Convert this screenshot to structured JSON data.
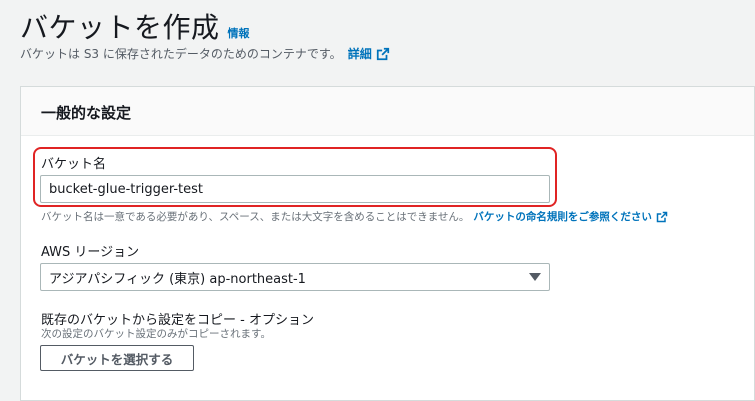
{
  "header": {
    "title": "バケットを作成",
    "info_link": "情報",
    "subtitle": "バケットは S3 に保存されたデータのためのコンテナです。",
    "detail_link": "詳細"
  },
  "panel": {
    "title": "一般的な設定",
    "bucket_name": {
      "label": "バケット名",
      "value": "bucket-glue-trigger-test",
      "help": "バケット名は一意である必要があり、スペース、または大文字を含めることはできません。",
      "help_link": "バケットの命名規則をご参照ください"
    },
    "region": {
      "label": "AWS リージョン",
      "selected": "アジアパシフィック (東京) ap-northeast-1"
    },
    "copy_settings": {
      "label": "既存のバケットから設定をコピー - オプション",
      "description": "次の設定のバケット設定のみがコピーされます。",
      "button": "バケットを選択する"
    }
  },
  "colors": {
    "link": "#0073bb",
    "highlight": "#e02424"
  },
  "icons": {
    "external": "external-link-icon",
    "dropdown": "caret-down-icon"
  }
}
